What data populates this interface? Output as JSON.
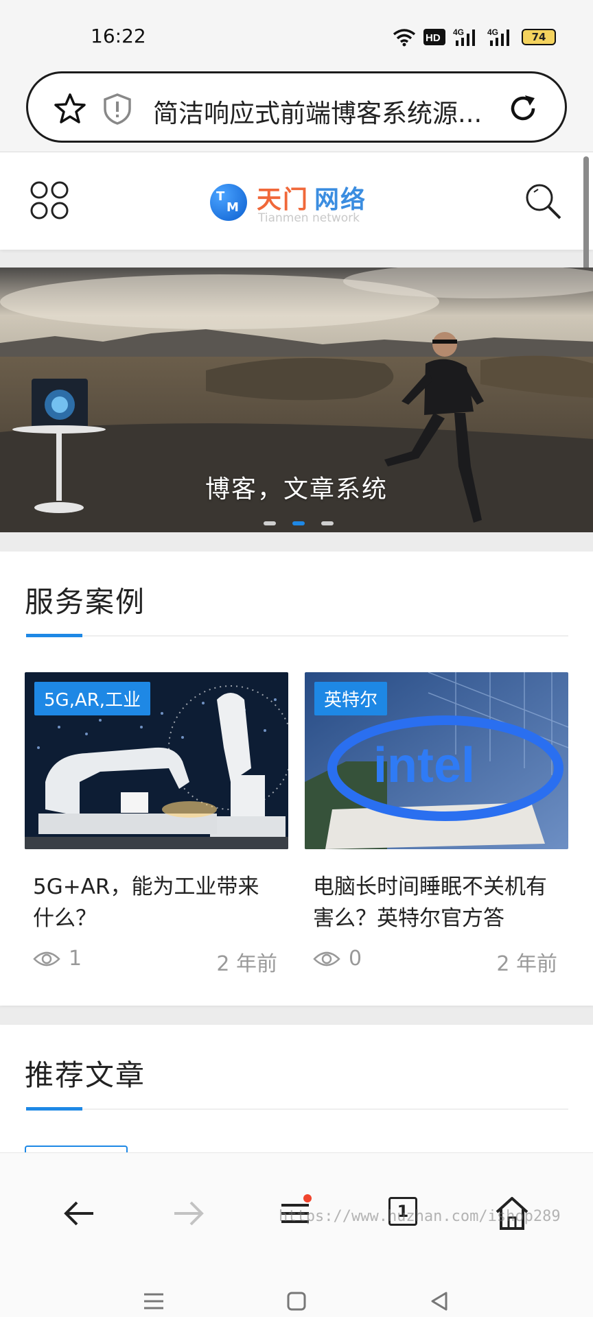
{
  "status_bar": {
    "time": "16:22",
    "hd_label": "HD",
    "net_1": "4G",
    "net_2": "4G",
    "battery": "74"
  },
  "address_bar": {
    "url_text": "简洁响应式前端博客系统源..."
  },
  "site": {
    "logo_name_1": "天门",
    "logo_name_2": "网络",
    "logo_sub": "Tianmen network",
    "logo_mark_1": "T",
    "logo_mark_2": "M"
  },
  "banner": {
    "caption": "博客，文章系统",
    "active_slide": 2,
    "slide_count": 3
  },
  "services": {
    "title": "服务案例",
    "posts": [
      {
        "tag": "5G,AR,工业",
        "title": "5G+AR，能为工业带来什么？",
        "views": "1",
        "time": "2 年前"
      },
      {
        "tag": "英特尔",
        "title": "电脑长时间睡眠不关机有害么？英特尔官方答",
        "views": "0",
        "time": "2 年前",
        "thumb_text": "intel"
      }
    ]
  },
  "recommended": {
    "title": "推荐文章"
  },
  "browser_nav": {
    "tab_count": "1",
    "watermark": "https://www.huzhan.com/ishop289"
  },
  "colors": {
    "accent": "#1e88e5",
    "logo_orange": "#f0683a",
    "logo_blue": "#3b8de0",
    "badge": "#f0452d"
  }
}
